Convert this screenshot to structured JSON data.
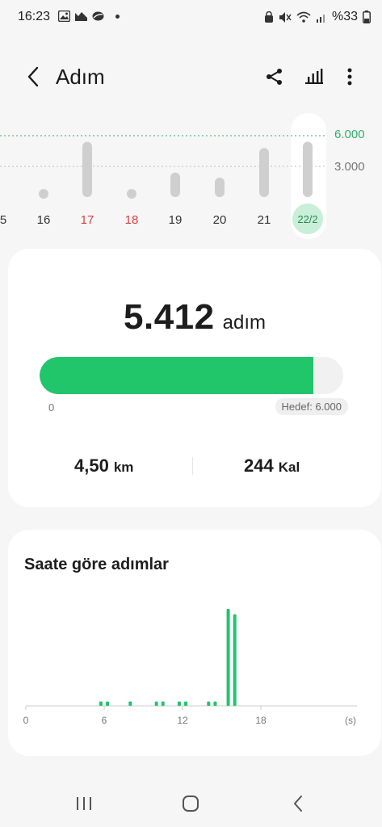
{
  "status_bar": {
    "time": "16:23",
    "battery": "%33"
  },
  "app_bar": {
    "title": "Adım",
    "icons": [
      "back-arrow-icon",
      "share-icon",
      "bar-stats-icon",
      "more-vert-icon"
    ]
  },
  "week_chart": {
    "goal_label": "6.000",
    "mid_label": "3.000",
    "days": [
      {
        "label": "5",
        "color": "#333333"
      },
      {
        "label": "16",
        "color": "#333333"
      },
      {
        "label": "17",
        "color": "#d94040"
      },
      {
        "label": "18",
        "color": "#d94040"
      },
      {
        "label": "19",
        "color": "#333333"
      },
      {
        "label": "20",
        "color": "#333333"
      },
      {
        "label": "21",
        "color": "#333333"
      },
      {
        "label": "22/2",
        "color": "#2a8a55"
      }
    ]
  },
  "chart_data": [
    {
      "type": "bar",
      "categories": [
        "16",
        "17",
        "18",
        "19",
        "20",
        "21",
        "22/2"
      ],
      "values": [
        300,
        5400,
        300,
        2400,
        1900,
        4800,
        5412
      ],
      "ylim": [
        0,
        6000
      ],
      "grid": true,
      "y_ticks": [
        "3.000",
        "6.000"
      ]
    },
    {
      "type": "bar",
      "title": "Saate göre adımlar",
      "x_ticks": [
        "0",
        "6",
        "12",
        "18",
        "(s)"
      ],
      "xlim": [
        0,
        24
      ],
      "x": [
        5.75,
        6.25,
        8.0,
        10.0,
        10.5,
        11.75,
        12.25,
        14.0,
        14.5,
        15.5,
        16.0
      ],
      "values": [
        80,
        80,
        80,
        80,
        80,
        80,
        80,
        80,
        80,
        1800,
        1700
      ]
    }
  ],
  "summary": {
    "steps_value": "5.412",
    "steps_unit": "adım",
    "progress_fraction": 0.902,
    "progress_start": "0",
    "goal_text": "Hedef: 6.000",
    "distance_value": "4,50",
    "distance_unit": "km",
    "calories_value": "244",
    "calories_unit": "Kal",
    "accent_color": "#21c56a"
  },
  "hourly": {
    "title": "Saate göre adımlar"
  },
  "nav_bar": {
    "icons": [
      "recents-icon",
      "home-icon",
      "back-icon"
    ]
  }
}
